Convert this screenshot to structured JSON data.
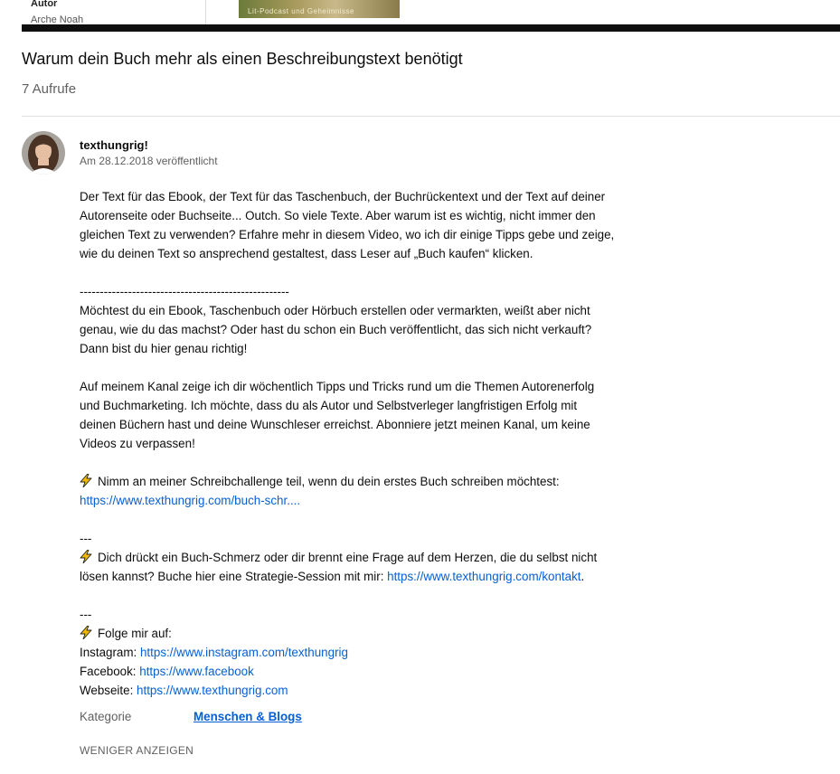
{
  "player": {
    "author_heading": "Autor",
    "author_name": "Arche Noah",
    "thumb_caption": "Lit-Podcast und Geheimnisse"
  },
  "video": {
    "title": "Warum dein Buch mehr als einen Beschreibungstext benötigt",
    "views": "7 Aufrufe"
  },
  "channel": {
    "name": "texthungrig!",
    "published": "Am 28.12.2018 veröffentlicht"
  },
  "description": {
    "p1_l1": "Der Text für das Ebook, der Text für das Taschenbuch, der Buchrückentext und der Text auf deiner",
    "p1_l2": "Autorenseite oder Buchseite... Outch. So viele Texte. Aber warum ist es wichtig, nicht immer den",
    "p1_l3": "gleichen Text zu verwenden? Erfahre mehr in diesem Video, wo ich dir einige Tipps gebe und zeige,",
    "p1_l4": "wie du deinen Text so ansprechend gestaltest, dass Leser auf „Buch kaufen“ klicken.",
    "separator_long": "----------------------------------------------------",
    "p2_l1": "Möchtest du ein Ebook, Taschenbuch oder Hörbuch erstellen oder vermarkten, weißt aber nicht",
    "p2_l2": "genau, wie du das machst? Oder hast du schon ein Buch veröffentlicht, das sich nicht verkauft?",
    "p2_l3": "Dann bist du hier genau richtig!",
    "p3_l1": "Auf meinem Kanal zeige ich dir wöchentlich Tipps und Tricks rund um die Themen Autorenerfolg",
    "p3_l2": "und Buchmarketing. Ich möchte, dass du als Autor und Selbstverleger langfristigen Erfolg mit",
    "p3_l3": "deinen Büchern hast und deine Wunschleser erreichst. Abonniere jetzt meinen Kanal, um keine",
    "p3_l4": "Videos zu verpassen!",
    "challenge_text": "Nimm an meiner Schreibchallenge teil, wenn du dein erstes Buch schreiben möchtest:",
    "challenge_link": "https://www.texthungrig.com/buch-schr....",
    "separator_short_1": "---",
    "session_l1": "Dich drückt ein Buch-Schmerz oder dir brennt eine Frage auf dem Herzen, die du selbst nicht",
    "session_l2": "lösen kannst? Buche hier eine Strategie-Session mit mir: ",
    "session_link": "https://www.texthungrig.com/kontakt",
    "session_end": ".",
    "separator_short_2": "---",
    "follow_label": "Folge mir auf:",
    "instagram_label": "Instagram: ",
    "instagram_link": "https://www.instagram.com/texthungrig",
    "facebook_label": "Facebook: ",
    "facebook_link": "https://www.facebook",
    "website_label": "Webseite: ",
    "website_link": "https://www.texthungrig.com"
  },
  "meta": {
    "category_label": "Kategorie",
    "category_value": "Menschen & Blogs"
  },
  "actions": {
    "show_less": "WENIGER ANZEIGEN"
  },
  "colors": {
    "link": "#065fd4",
    "secondary_text": "#606060",
    "bolt": "#f5b800"
  },
  "icons": {
    "bolt": "high-voltage-icon"
  }
}
